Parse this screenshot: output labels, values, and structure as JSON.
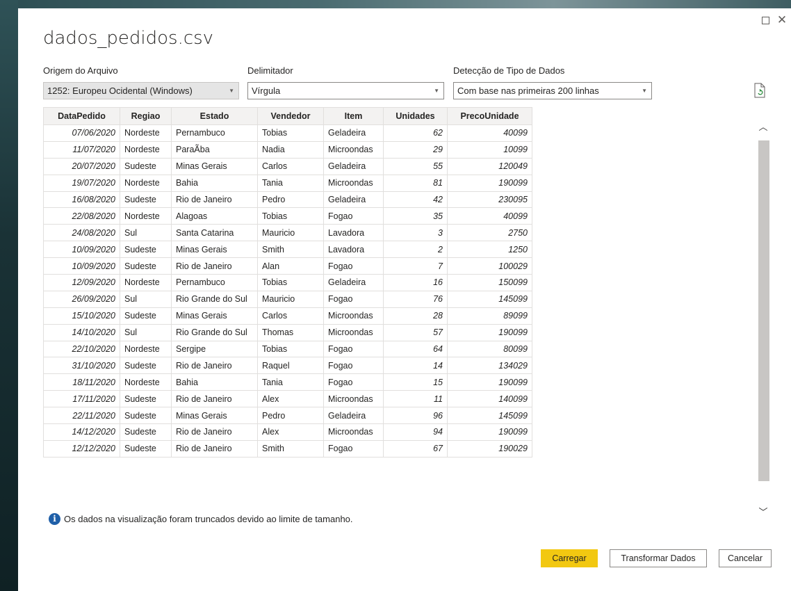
{
  "window": {
    "maximize_icon": "maximize-icon",
    "close_label": "✕"
  },
  "title": "dados_pedidos.csv",
  "fields": {
    "origem": {
      "label": "Origem do Arquivo",
      "value": "1252: Europeu Ocidental (Windows)"
    },
    "delimitador": {
      "label": "Delimitador",
      "value": "Vírgula"
    },
    "deteccao": {
      "label": "Detecção de Tipo de Dados",
      "value": "Com base nas primeiras 200 linhas"
    }
  },
  "table": {
    "columns": [
      "DataPedido",
      "Regiao",
      "Estado",
      "Vendedor",
      "Item",
      "Unidades",
      "PrecoUnidade"
    ],
    "rows": [
      [
        "07/06/2020",
        "Nordeste",
        "Pernambuco",
        "Tobias",
        "Geladeira",
        "62",
        "40099"
      ],
      [
        "11/07/2020",
        "Nordeste",
        "ParaÃba",
        "Nadia",
        "Microondas",
        "29",
        "10099"
      ],
      [
        "20/07/2020",
        "Sudeste",
        "Minas Gerais",
        "Carlos",
        "Geladeira",
        "55",
        "120049"
      ],
      [
        "19/07/2020",
        "Nordeste",
        "Bahia",
        "Tania",
        "Microondas",
        "81",
        "190099"
      ],
      [
        "16/08/2020",
        "Sudeste",
        "Rio de Janeiro",
        "Pedro",
        "Geladeira",
        "42",
        "230095"
      ],
      [
        "22/08/2020",
        "Nordeste",
        "Alagoas",
        "Tobias",
        "Fogao",
        "35",
        "40099"
      ],
      [
        "24/08/2020",
        "Sul",
        "Santa Catarina",
        "Mauricio",
        "Lavadora",
        "3",
        "2750"
      ],
      [
        "10/09/2020",
        "Sudeste",
        "Minas Gerais",
        "Smith",
        "Lavadora",
        "2",
        "1250"
      ],
      [
        "10/09/2020",
        "Sudeste",
        "Rio de Janeiro",
        "Alan",
        "Fogao",
        "7",
        "100029"
      ],
      [
        "12/09/2020",
        "Nordeste",
        "Pernambuco",
        "Tobias",
        "Geladeira",
        "16",
        "150099"
      ],
      [
        "26/09/2020",
        "Sul",
        "Rio Grande do Sul",
        "Mauricio",
        "Fogao",
        "76",
        "145099"
      ],
      [
        "15/10/2020",
        "Sudeste",
        "Minas Gerais",
        "Carlos",
        "Microondas",
        "28",
        "89099"
      ],
      [
        "14/10/2020",
        "Sul",
        "Rio Grande do Sul",
        "Thomas",
        "Microondas",
        "57",
        "190099"
      ],
      [
        "22/10/2020",
        "Nordeste",
        "Sergipe",
        "Tobias",
        "Fogao",
        "64",
        "80099"
      ],
      [
        "31/10/2020",
        "Sudeste",
        "Rio de Janeiro",
        "Raquel",
        "Fogao",
        "14",
        "134029"
      ],
      [
        "18/11/2020",
        "Nordeste",
        "Bahia",
        "Tania",
        "Fogao",
        "15",
        "190099"
      ],
      [
        "17/11/2020",
        "Sudeste",
        "Rio de Janeiro",
        "Alex",
        "Microondas",
        "11",
        "140099"
      ],
      [
        "22/11/2020",
        "Sudeste",
        "Minas Gerais",
        "Pedro",
        "Geladeira",
        "96",
        "145099"
      ],
      [
        "14/12/2020",
        "Sudeste",
        "Rio de Janeiro",
        "Alex",
        "Microondas",
        "94",
        "190099"
      ],
      [
        "12/12/2020",
        "Sudeste",
        "Rio de Janeiro",
        "Smith",
        "Fogao",
        "67",
        "190029"
      ]
    ]
  },
  "note": "Os dados na visualização foram truncados devido ao limite de tamanho.",
  "buttons": {
    "load": "Carregar",
    "transform": "Transformar Dados",
    "cancel": "Cancelar"
  },
  "colors": {
    "primary_button": "#f2c811",
    "info_icon": "#1f5fa8"
  }
}
